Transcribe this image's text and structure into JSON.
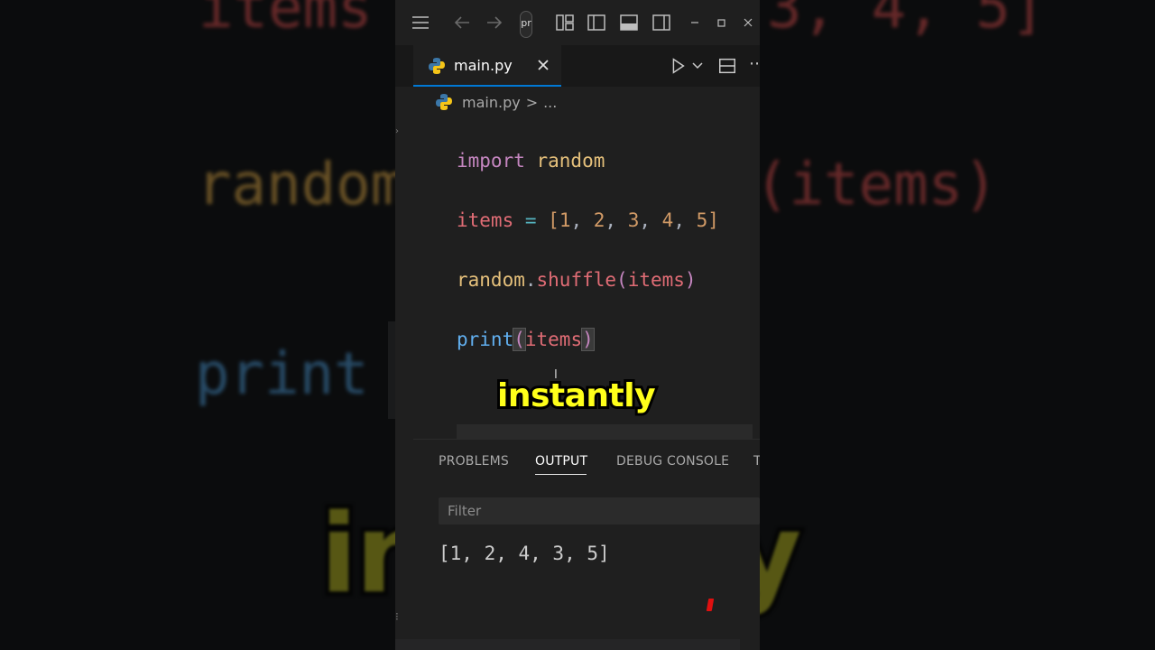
{
  "background": {
    "line1_left": "items",
    "line1_right": "3, 4, 5]",
    "line2_left": "random",
    "line2_right": "(items)",
    "line3_left": "print",
    "caption_left": "in",
    "caption_right": "y"
  },
  "titlebar": {
    "command_center_text": "pr"
  },
  "tab": {
    "label": "main.py",
    "active": true
  },
  "breadcrumb": {
    "file": "main.py",
    "separator": ">",
    "rest": "..."
  },
  "code": {
    "lines": [
      {
        "kw": "import",
        "rest": " random"
      },
      {
        "var": "items",
        "op": " = ",
        "open": "[",
        "n1": "1",
        "c1": ", ",
        "n2": "2",
        "c2": ", ",
        "n3": "3",
        "c3": ", ",
        "n4": "4",
        "c4": ", ",
        "n5": "5",
        "close": "]"
      },
      {
        "mod": "random",
        "dot": ".",
        "fn": "shuffle",
        "open": "(",
        "arg": "items",
        "close": ")"
      },
      {
        "fn": "print",
        "open": "(",
        "arg": "items",
        "close": ")"
      }
    ]
  },
  "caption": "instantly",
  "panel": {
    "tabs": [
      "PROBLEMS",
      "OUTPUT",
      "DEBUG CONSOLE",
      "T"
    ],
    "active_tab": "OUTPUT",
    "filter_placeholder": "Filter",
    "output": "[1, 2, 4, 3, 5]"
  },
  "colors": {
    "accent": "#0078d4",
    "caption": "#ffff1a",
    "editor_bg": "#1f1f1f"
  }
}
